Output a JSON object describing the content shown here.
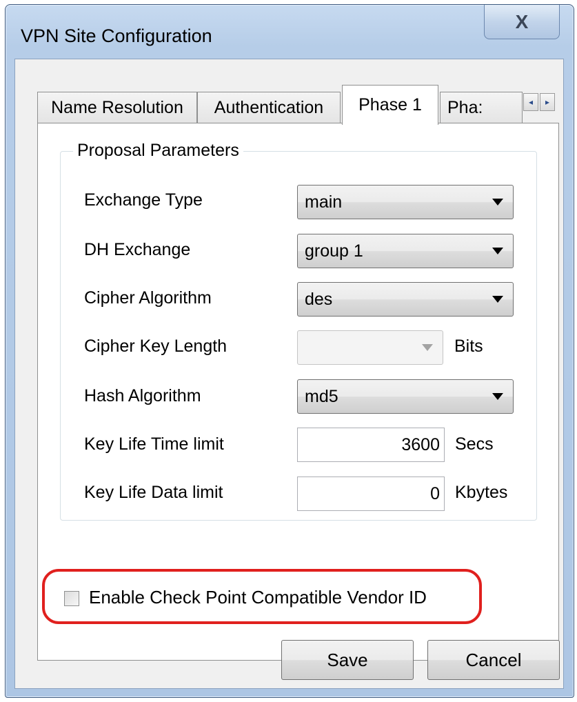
{
  "window": {
    "title": "VPN Site Configuration",
    "close_glyph": "X"
  },
  "tabs": [
    {
      "label": "Name Resolution",
      "active": false
    },
    {
      "label": "Authentication",
      "active": false
    },
    {
      "label": "Phase 1",
      "active": true
    },
    {
      "label": "Pha:",
      "active": false
    }
  ],
  "tab_scroll": {
    "left_glyph": "◂",
    "right_glyph": "▸"
  },
  "proposal": {
    "legend": "Proposal Parameters",
    "exchange_type": {
      "label": "Exchange Type",
      "value": "main"
    },
    "dh_exchange": {
      "label": "DH Exchange",
      "value": "group 1"
    },
    "cipher_algorithm": {
      "label": "Cipher Algorithm",
      "value": "des"
    },
    "cipher_key_length": {
      "label": "Cipher Key Length",
      "value": "",
      "unit": "Bits"
    },
    "hash_algorithm": {
      "label": "Hash Algorithm",
      "value": "md5"
    },
    "key_life_time": {
      "label": "Key Life Time limit",
      "value": "3600",
      "unit": "Secs"
    },
    "key_life_data": {
      "label": "Key Life Data limit",
      "value": "0",
      "unit": "Kbytes"
    }
  },
  "vendor_id": {
    "label": "Enable Check Point Compatible Vendor ID",
    "checked": false,
    "highlight_color": "#e0201e"
  },
  "buttons": {
    "save": "Save",
    "cancel": "Cancel"
  }
}
